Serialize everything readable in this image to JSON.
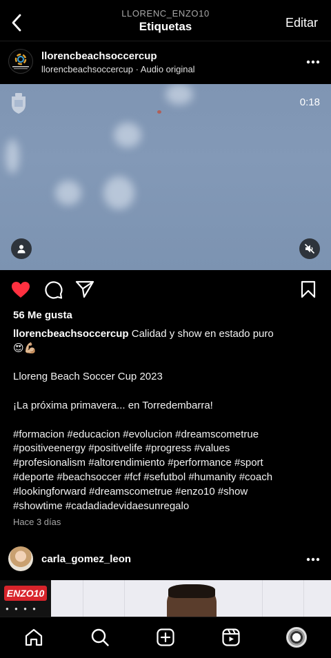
{
  "header": {
    "subtitle": "LLORENC_ENZO10",
    "title": "Etiquetas",
    "edit_label": "Editar"
  },
  "post": {
    "username": "llorencbeachsoccercup",
    "audio": "llorencbeachsoccercup · Audio original",
    "video_time": "0:18",
    "likes": "56 Me gusta",
    "caption_text": "Calidad y show en estado puro",
    "caption_emoji": "😍💪🏼",
    "lines": [
      "Lloreng Beach Soccer Cup 2023",
      "¡La próxima primavera... en Torredembarra!"
    ],
    "hashtags": [
      "#formacion #educacion #evolucion #dreamscometrue",
      "#positiveenergy #positivelife #progress #values",
      "#profesionalism #altorendimiento #performance #sport",
      "#deporte #beachsoccer #fcf #sefutbol #humanity #coach",
      "#lookingforward #dreamscometrue #enzo10 #show",
      "#showtime #cadadiadevidaesunregalo"
    ],
    "time_ago": "Hace 3 días",
    "liked": true,
    "like_color": "#ff3040"
  },
  "post2": {
    "username": "carla_gomez_leon",
    "brand_logo": "ENZO10"
  },
  "nav": {
    "items": [
      "home-icon",
      "search-icon",
      "create-icon",
      "reels-icon",
      "profile-avatar"
    ]
  }
}
